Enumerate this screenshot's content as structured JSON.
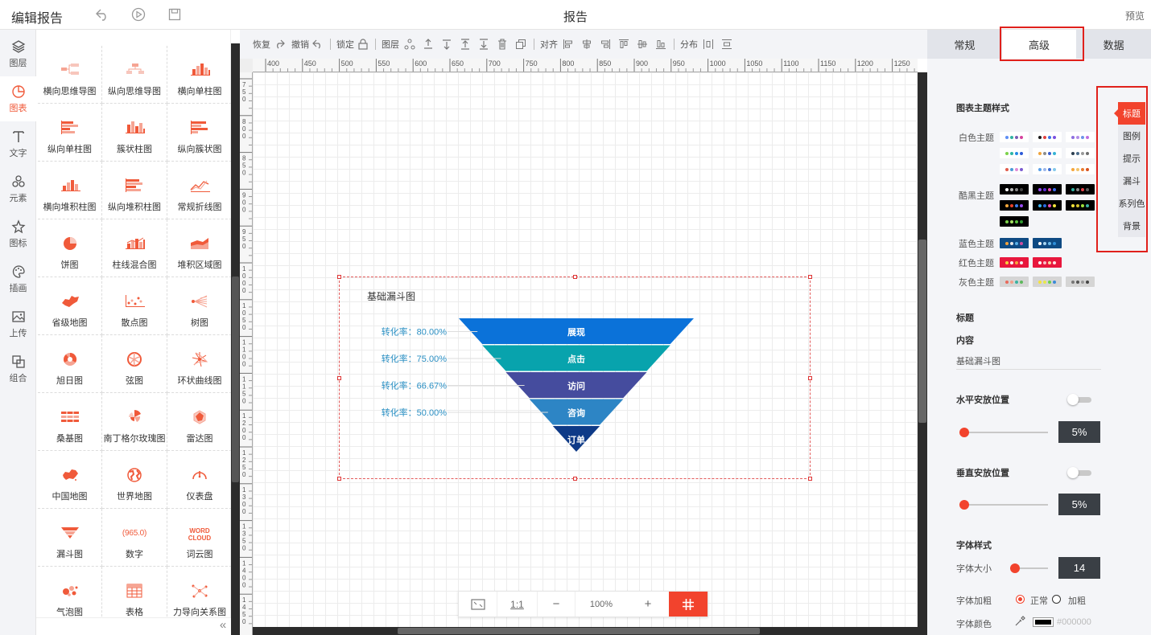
{
  "header": {
    "app_title": "编辑报告",
    "report_title": "报告",
    "preview": "预览"
  },
  "iconbar": [
    {
      "label": "图层",
      "icon": "layers-icon"
    },
    {
      "label": "图表",
      "icon": "chart-icon"
    },
    {
      "label": "文字",
      "icon": "text-icon"
    },
    {
      "label": "元素",
      "icon": "elements-icon"
    },
    {
      "label": "图标",
      "icon": "star-icon"
    },
    {
      "label": "插画",
      "icon": "palette-icon"
    },
    {
      "label": "上传",
      "icon": "image-upload-icon"
    },
    {
      "label": "组合",
      "icon": "group-icon"
    }
  ],
  "palette": [
    {
      "label": "横向思维导图",
      "icon": "mindmap-h-icon"
    },
    {
      "label": "纵向思维导图",
      "icon": "mindmap-v-icon"
    },
    {
      "label": "横向单柱图",
      "icon": "bar-icon"
    },
    {
      "label": "纵向单柱图",
      "icon": "hbar-icon"
    },
    {
      "label": "簇状柱图",
      "icon": "cluster-bar-icon"
    },
    {
      "label": "纵向簇状图",
      "icon": "cluster-hbar-icon"
    },
    {
      "label": "横向堆积柱图",
      "icon": "stacked-bar-icon"
    },
    {
      "label": "纵向堆积柱图",
      "icon": "stacked-hbar-icon"
    },
    {
      "label": "常规折线图",
      "icon": "line-icon"
    },
    {
      "label": "饼图",
      "icon": "pie-icon"
    },
    {
      "label": "柱线混合图",
      "icon": "bar-line-icon"
    },
    {
      "label": "堆积区域图",
      "icon": "area-icon"
    },
    {
      "label": "省级地图",
      "icon": "province-map-icon"
    },
    {
      "label": "散点图",
      "icon": "scatter-icon"
    },
    {
      "label": "树图",
      "icon": "tree-icon"
    },
    {
      "label": "旭日图",
      "icon": "sunburst-icon"
    },
    {
      "label": "弦图",
      "icon": "chord-icon"
    },
    {
      "label": "环状曲线图",
      "icon": "radial-curve-icon"
    },
    {
      "label": "桑基图",
      "icon": "sankey-icon"
    },
    {
      "label": "南丁格尔玫瑰图",
      "icon": "rose-icon"
    },
    {
      "label": "雷达图",
      "icon": "radar-icon"
    },
    {
      "label": "中国地图",
      "icon": "china-map-icon"
    },
    {
      "label": "世界地图",
      "icon": "globe-icon"
    },
    {
      "label": "仪表盘",
      "icon": "gauge-icon"
    },
    {
      "label": "漏斗图",
      "icon": "funnel-icon"
    },
    {
      "label": "数字",
      "icon": "number-icon",
      "icon_text": "965.0"
    },
    {
      "label": "词云图",
      "icon": "wordcloud-icon",
      "icon_text": "WORD CLOUD"
    },
    {
      "label": "气泡图",
      "icon": "bubble-icon"
    },
    {
      "label": "表格",
      "icon": "table-icon"
    },
    {
      "label": "力导向关系图",
      "icon": "force-graph-icon"
    }
  ],
  "toolbar": {
    "redo": "恢复",
    "undo": "撤销",
    "lock": "锁定",
    "layer": "图层",
    "align": "对齐",
    "distribute": "分布"
  },
  "ruler": {
    "h": [
      "400",
      "450",
      "500",
      "550",
      "600",
      "650",
      "700",
      "750",
      "800",
      "850",
      "900",
      "950",
      "1000",
      "1050",
      "1100",
      "1150",
      "1200",
      "1250"
    ],
    "v": [
      "750",
      "800",
      "850",
      "900",
      "950",
      "1000",
      "1050",
      "1100",
      "1150",
      "1200",
      "1250",
      "1300",
      "1350",
      "1400",
      "1450"
    ]
  },
  "zoom": {
    "ratio": "1:1",
    "minus": "−",
    "value": "100%",
    "plus": "+"
  },
  "chart_data": {
    "type": "funnel",
    "title": "基础漏斗图",
    "categories": [
      "展现",
      "点击",
      "访问",
      "咨询",
      "订单"
    ],
    "values": [
      100,
      80,
      60,
      40,
      20
    ],
    "colors": [
      "#0b72d9",
      "#08a3ad",
      "#454c9e",
      "#2d85c5",
      "#0e3a87"
    ],
    "conversion_prefix": "转化率：",
    "conversion_rates": [
      "80.00%",
      "75.00%",
      "66.67%",
      "50.00%"
    ]
  },
  "right_panel": {
    "tabs": [
      "常规",
      "高级",
      "数据"
    ],
    "active_tab": 1,
    "side_tabs": [
      "标题",
      "图例",
      "提示",
      "漏斗",
      "系列色",
      "背景"
    ],
    "theme_section": "图表主题样式",
    "themes": [
      {
        "name": "白色主题",
        "bg": "#ffffff",
        "swatches": [
          [
            "#5d8ef5",
            "#2fb2a2",
            "#775cb5",
            "#d6419d"
          ],
          [
            "#1a1a1a",
            "#e14141",
            "#3b72e6",
            "#7a4fe0"
          ],
          [
            "#8d6ee0",
            "#b38de8",
            "#6d92e8",
            "#c06ee0"
          ],
          [
            "#7cd34a",
            "#2bb5a6",
            "#2489e6",
            "#2c59d8"
          ],
          [
            "#f0a33c",
            "#8c8c8c",
            "#3a5fd0",
            "#37b3d4"
          ],
          [
            "#2c3e50",
            "#4a6b8a",
            "#999999",
            "#6d6d6d"
          ],
          [
            "#e15b4b",
            "#4a9ad8",
            "#e08ad6",
            "#7b5bd0"
          ],
          [
            "#5aa0e8",
            "#9bb6ec",
            "#3f6fd4",
            "#84c8ea"
          ],
          [
            "#f5a63b",
            "#f2c36a",
            "#e97b2f",
            "#d8521e"
          ]
        ]
      },
      {
        "name": "酷黑主题",
        "bg": "#000000",
        "swatches": [
          [
            "#ffffff",
            "#bbbbbb",
            "#888888",
            "#444444"
          ],
          [
            "#9a4cf5",
            "#5c2bd8",
            "#e84cb0",
            "#3b6af0"
          ],
          [
            "#2fb3a2",
            "#888888",
            "#e6434b",
            "#5c5c5c"
          ],
          [
            "#f5a93b",
            "#e8432b",
            "#3b7ff0",
            "#9a4cf5"
          ],
          [
            "#3bb2f0",
            "#2a6ae0",
            "#e84cb0",
            "#f5e33b"
          ],
          [
            "#f5e33b",
            "#d6c32b",
            "#a0e03b",
            "#3bb2a0"
          ],
          [
            "#7cd34a",
            "#a4e063",
            "#58c13a",
            "#2f9a2f"
          ]
        ]
      },
      {
        "name": "蓝色主题",
        "bg": "#0e4a83",
        "swatches": [
          [
            "#f2a23b",
            "#e8e8e8",
            "#5cb2e8",
            "#d04da0"
          ],
          [
            "#ffffff",
            "#a8d4f0",
            "#6ab8e8",
            "#2e8ed8"
          ]
        ]
      },
      {
        "name": "红色主题",
        "bg": "#e8173d",
        "swatches": [
          [
            "#f5d33b",
            "#ffffff",
            "#f5a63b",
            "#f2f2f2"
          ],
          [
            "#ffffff",
            "#f8c0c8",
            "#f8d8a0",
            "#ffe4e8"
          ]
        ]
      },
      {
        "name": "灰色主题",
        "bg": "#d5d5d5",
        "swatches": [
          [
            "#e86a5c",
            "#f0a08a",
            "#3ab2a0",
            "#5cb85c"
          ],
          [
            "#f5e33b",
            "#e8e84c",
            "#6ad04c",
            "#3a8ad8"
          ],
          [
            "#777777",
            "#555555",
            "#999999",
            "#444444"
          ]
        ]
      }
    ],
    "title_section": "标题",
    "content_label": "内容",
    "content_value": "基础漏斗图",
    "h_pos_label": "水平安放位置",
    "h_pos_value": "5%",
    "h_pos_fraction": 0.05,
    "v_pos_label": "垂直安放位置",
    "v_pos_value": "5%",
    "v_pos_fraction": 0.05,
    "font_section": "字体样式",
    "font_size_label": "字体大小",
    "font_size_value": "14",
    "font_size_fraction": 0.1,
    "font_weight_label": "字体加粗",
    "font_weight_normal": "正常",
    "font_weight_bold": "加粗",
    "font_color_label": "字体颜色",
    "font_color_value": "#000000"
  }
}
